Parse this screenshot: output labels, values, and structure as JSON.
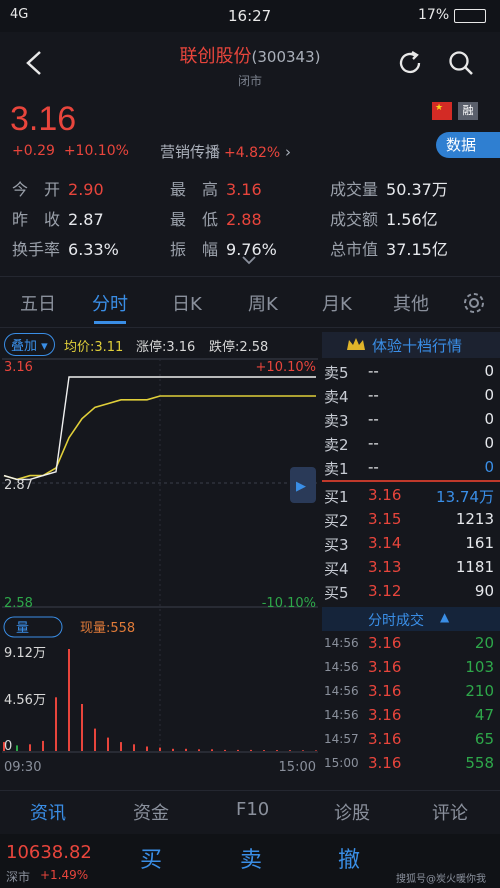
{
  "status": {
    "signal": "4G",
    "time": "16:27",
    "battery": "17%"
  },
  "header": {
    "title": "联创股份",
    "code": "(300343)",
    "subtitle": "闭市"
  },
  "quote": {
    "price": "3.16",
    "change": "+0.29",
    "change_pct": "+10.10%",
    "sector": "营销传播",
    "sector_pct": "+4.82%",
    "data_button": "数据"
  },
  "stats": [
    {
      "label": "今　开",
      "value": "2.90",
      "color": "red"
    },
    {
      "label": "最　高",
      "value": "3.16",
      "color": "red"
    },
    {
      "label": "成交量",
      "value": "50.37万",
      "color": "white"
    },
    {
      "label": "昨　收",
      "value": "2.87",
      "color": "white"
    },
    {
      "label": "最　低",
      "value": "2.88",
      "color": "red"
    },
    {
      "label": "成交额",
      "value": "1.56亿",
      "color": "white"
    },
    {
      "label": "换手率",
      "value": "6.33%",
      "color": "white"
    },
    {
      "label": "振　幅",
      "value": "9.76%",
      "color": "white"
    },
    {
      "label": "总市值",
      "value": "37.15亿",
      "color": "white"
    }
  ],
  "tabs": [
    "五日",
    "分时",
    "日K",
    "周K",
    "月K",
    "其他"
  ],
  "chart_header": {
    "overlay": "叠加",
    "avg": "均价:3.11",
    "limit_up": "涨停:3.16",
    "limit_down": "跌停:2.58"
  },
  "chart_data": {
    "type": "line",
    "price_axis": {
      "top": "3.16",
      "mid": "2.87",
      "bottom": "2.58",
      "top_pct": "+10.10%",
      "bottom_pct": "-10.10%",
      "ylim": [
        2.58,
        3.16
      ],
      "prev_close": 2.87
    },
    "volume_axis": {
      "label": "量",
      "current": "现量:558",
      "top": "9.12万",
      "mid": "4.56万",
      "bottom": "0",
      "ylim": [
        0,
        91200
      ]
    },
    "x_labels": [
      "09:30",
      "15:00"
    ],
    "price": [
      2.9,
      2.89,
      2.89,
      2.9,
      2.91,
      3.16,
      3.16,
      3.16,
      3.16,
      3.16,
      3.16,
      3.16,
      3.16,
      3.16,
      3.16,
      3.16,
      3.16,
      3.16,
      3.16,
      3.16,
      3.16,
      3.16,
      3.16,
      3.16,
      3.16
    ],
    "avg": [
      2.9,
      2.89,
      2.9,
      2.9,
      2.92,
      3.0,
      3.05,
      3.08,
      3.09,
      3.1,
      3.1,
      3.1,
      3.11,
      3.11,
      3.11,
      3.11,
      3.11,
      3.11,
      3.11,
      3.11,
      3.11,
      3.11,
      3.11,
      3.11,
      3.11
    ],
    "volume": [
      8000,
      5000,
      6000,
      9000,
      48000,
      91200,
      42000,
      20000,
      12000,
      8000,
      6000,
      4000,
      3000,
      2000,
      2000,
      1500,
      1500,
      1000,
      1000,
      1000,
      800,
      800,
      700,
      600,
      558
    ]
  },
  "orderbook": {
    "title": "体验十档行情",
    "asks": [
      {
        "label": "卖5",
        "price": "--",
        "vol": "0"
      },
      {
        "label": "卖4",
        "price": "--",
        "vol": "0"
      },
      {
        "label": "卖3",
        "price": "--",
        "vol": "0"
      },
      {
        "label": "卖2",
        "price": "--",
        "vol": "0"
      },
      {
        "label": "卖1",
        "price": "--",
        "vol": "0"
      }
    ],
    "bids": [
      {
        "label": "买1",
        "price": "3.16",
        "vol": "13.74万"
      },
      {
        "label": "买2",
        "price": "3.15",
        "vol": "1213"
      },
      {
        "label": "买3",
        "price": "3.14",
        "vol": "161"
      },
      {
        "label": "买4",
        "price": "3.13",
        "vol": "1181"
      },
      {
        "label": "买5",
        "price": "3.12",
        "vol": "90"
      }
    ]
  },
  "ticks": {
    "title": "分时成交",
    "rows": [
      {
        "time": "14:56",
        "price": "3.16",
        "vol": "20"
      },
      {
        "time": "14:56",
        "price": "3.16",
        "vol": "103"
      },
      {
        "time": "14:56",
        "price": "3.16",
        "vol": "210"
      },
      {
        "time": "14:56",
        "price": "3.16",
        "vol": "47"
      },
      {
        "time": "14:57",
        "price": "3.16",
        "vol": "65"
      },
      {
        "time": "15:00",
        "price": "3.16",
        "vol": "558"
      }
    ]
  },
  "bottom_nav": [
    "资讯",
    "资金",
    "F10",
    "诊股",
    "评论"
  ],
  "bottom_bar": {
    "index_value": "10638.82",
    "index_name": "深市",
    "index_pct": "+1.49%",
    "buy": "买",
    "sell": "卖",
    "cancel": "撤",
    "footer": "搜狐号@炭火暖你我"
  },
  "colors": {
    "up": "#e8453c",
    "down": "#2ea84a",
    "accent": "#3a8ee6",
    "avg_line": "#e0cf3a",
    "bg": "#15171d"
  }
}
